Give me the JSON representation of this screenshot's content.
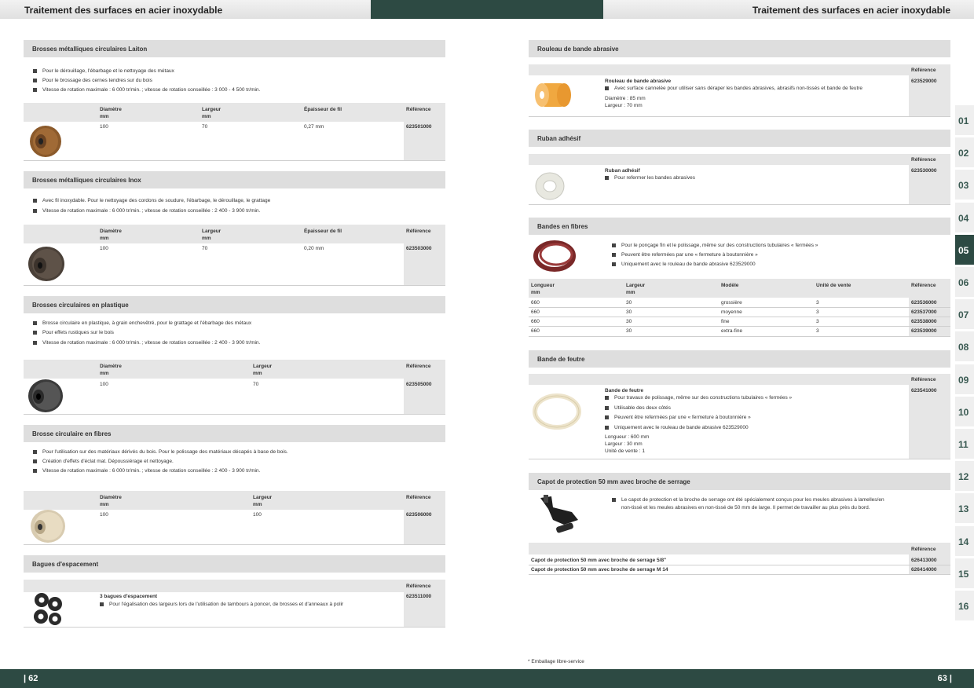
{
  "header": {
    "left_title": "Traitement des surfaces en acier inoxydable",
    "right_title": "Traitement des surfaces en acier inoxydable"
  },
  "footer": {
    "left_page": "| 62",
    "right_page": "63 |",
    "footnote": "* Emballage libre-service"
  },
  "tabs": [
    "01",
    "02",
    "03",
    "04",
    "05",
    "06",
    "07",
    "08",
    "09",
    "10",
    "11",
    "12",
    "13",
    "14",
    "15",
    "16"
  ],
  "active_tab": "05",
  "left": {
    "laiton": {
      "title": "Brosses métalliques circulaires Laiton",
      "bullets": [
        "Pour le dérouillage, l'ébarbage et le nettoyage des métaux",
        "Pour le brossage des cernes tendres sur du bois",
        "Vitesse de rotation maximale : 6 000 tr/min. ; vitesse de rotation conseillée : 3 000 - 4 500 tr/min."
      ],
      "th": [
        "Diamètre",
        "mm",
        "Largeur",
        "mm",
        "Épaisseur de fil",
        "Référence"
      ],
      "row": [
        "100",
        "70",
        "0,27 mm",
        "623501000"
      ]
    },
    "inox": {
      "title": "Brosses métalliques circulaires Inox",
      "bullets": [
        "Avec fil inoxydable. Pour le nettoyage des cordons de soudure, l'ébarbage, le dérouillage, le grattage",
        "Vitesse de rotation maximale : 6 000 tr/min. ; vitesse de rotation conseillée : 2 400 - 3 900 tr/min."
      ],
      "th": [
        "Diamètre",
        "mm",
        "Largeur",
        "mm",
        "Épaisseur de fil",
        "Référence"
      ],
      "row": [
        "100",
        "70",
        "0,20 mm",
        "623503000"
      ]
    },
    "plastique": {
      "title": "Brosses circulaires en plastique",
      "bullets": [
        "Brosse circulaire en plastique, à grain enchevêtré, pour le grattage et l'ébarbage des métaux",
        "Pour effets rustiques sur le bois",
        "Vitesse de rotation maximale : 6 000 tr/min. ; vitesse de rotation conseillée : 2 400 - 3 900 tr/min."
      ],
      "th": [
        "Diamètre",
        "mm",
        "Largeur",
        "mm",
        "Référence"
      ],
      "row": [
        "100",
        "70",
        "623505000"
      ]
    },
    "fibres": {
      "title": "Brosse circulaire en fibres",
      "bullets": [
        "Pour l'utilisation sur des matériaux dérivés du bois. Pour le polissage des matériaux décapés à base de bois.",
        "Création d'effets d'éclat mat. Dépoussiérage et nettoyage.",
        "Vitesse de rotation maximale : 6 000 tr/min. ; vitesse de rotation conseillée : 2 400 - 3 900 tr/min."
      ],
      "th": [
        "Diamètre",
        "mm",
        "Largeur",
        "mm",
        "Référence"
      ],
      "row": [
        "100",
        "100",
        "623506000"
      ]
    },
    "bagues": {
      "title": "Bagues d'espacement",
      "th_ref": "Référence",
      "name": "3 bagues d'espacement",
      "bullet": "Pour l'égalisation des largeurs lors de l'utilisation de tambours à poncer, de brosses et d'anneaux à polir",
      "ref": "623511000"
    }
  },
  "right": {
    "rouleau": {
      "title": "Rouleau de bande abrasive",
      "th_ref": "Référence",
      "name": "Rouleau de bande abrasive",
      "bullet": "Avec surface cannelée pour utiliser sans déraper les bandes abrasives, abrasifs non-tissés et bande de feutre",
      "spec1": "Diamètre : 85 mm",
      "spec2": "Largeur : 70 mm",
      "ref": "623529000"
    },
    "ruban": {
      "title": "Ruban adhésif",
      "th_ref": "Référence",
      "name": "Ruban adhésif",
      "bullet": "Pour refermer les bandes abrasives",
      "ref": "623530000"
    },
    "bandes": {
      "title": "Bandes en fibres",
      "bullets": [
        "Pour le ponçage fin et le polissage, même sur des constructions tubulaires « fermées »",
        "Peuvent être refermées par une « fermeture à boutonnière »",
        "Uniquement avec le rouleau de bande abrasive 623529000"
      ],
      "th": [
        "Longueur",
        "mm",
        "Largeur",
        "mm",
        "Modèle",
        "Unité de vente",
        "Référence"
      ],
      "rows": [
        [
          "660",
          "30",
          "grossière",
          "3",
          "623536000"
        ],
        [
          "660",
          "30",
          "moyenne",
          "3",
          "623537000"
        ],
        [
          "660",
          "30",
          "fine",
          "3",
          "623538000"
        ],
        [
          "660",
          "30",
          "extra-fine",
          "3",
          "623539000"
        ]
      ]
    },
    "feutre": {
      "title": "Bande de feutre",
      "th_ref": "Référence",
      "name": "Bande de feutre",
      "bullets": [
        "Pour travaux de polissage, même sur des constructions tubulaires « fermées »",
        "Utilisable des deux côtés",
        "Peuvent être refermées par une « fermeture à boutonnière »",
        "Uniquement avec le rouleau de bande abrasive 623529000"
      ],
      "spec1": "Longueur : 600 mm",
      "spec2": "Largeur : 30 mm",
      "spec3": "Unité de vente : 1",
      "ref": "623541000"
    },
    "capot": {
      "title": "Capot de protection 50 mm avec broche de serrage",
      "bullet_l1": "Le capot de protection et la broche de serrage ont été spécialement conçus pour les meules abrasives à lamelles/en",
      "bullet_l2": "non-tissé et les meules abrasives en non-tissé de 50 mm de large. Il permet de travailler au plus près du bord.",
      "th_ref": "Référence",
      "rows": [
        [
          "Capot de protection 50 mm avec broche de serrage 5/8\"",
          "626413000"
        ],
        [
          "Capot de protection 50 mm avec broche de serrage M 14",
          "626414000"
        ]
      ]
    }
  }
}
